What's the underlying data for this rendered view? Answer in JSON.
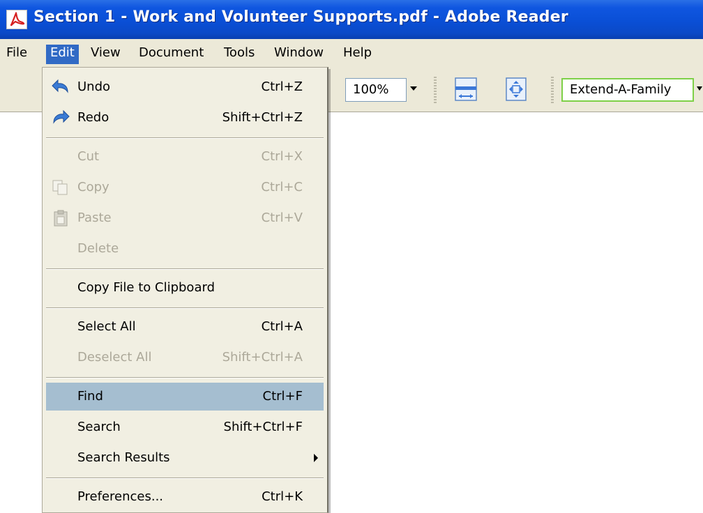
{
  "window": {
    "title": "Section 1 - Work and Volunteer Supports.pdf - Adobe Reader",
    "app_icon": "adobe-reader-icon",
    "title_bar_color": "#0a4fd6"
  },
  "menubar": {
    "items": [
      {
        "label": "File"
      },
      {
        "label": "Edit",
        "active": true
      },
      {
        "label": "View"
      },
      {
        "label": "Document"
      },
      {
        "label": "Tools"
      },
      {
        "label": "Window"
      },
      {
        "label": "Help"
      }
    ]
  },
  "toolbar": {
    "zoom_value": "100%",
    "fit_width_icon": "fit-width-icon",
    "fit_page_icon": "fit-page-icon",
    "search_value": "Extend-A-Family"
  },
  "edit_menu": {
    "items": [
      {
        "label": "Undo",
        "shortcut": "Ctrl+Z",
        "icon": "undo-icon",
        "enabled": true
      },
      {
        "label": "Redo",
        "shortcut": "Shift+Ctrl+Z",
        "icon": "redo-icon",
        "enabled": true
      },
      {
        "label": "Cut",
        "shortcut": "Ctrl+X",
        "enabled": false
      },
      {
        "label": "Copy",
        "shortcut": "Ctrl+C",
        "icon": "copy-icon",
        "enabled": false
      },
      {
        "label": "Paste",
        "shortcut": "Ctrl+V",
        "icon": "paste-icon",
        "enabled": false
      },
      {
        "label": "Delete",
        "shortcut": "",
        "enabled": false
      },
      {
        "label": "Copy File to Clipboard",
        "shortcut": "",
        "enabled": true
      },
      {
        "label": "Select All",
        "shortcut": "Ctrl+A",
        "enabled": true
      },
      {
        "label": "Deselect All",
        "shortcut": "Shift+Ctrl+A",
        "enabled": false
      },
      {
        "label": "Find",
        "shortcut": "Ctrl+F",
        "enabled": true,
        "highlighted": true
      },
      {
        "label": "Search",
        "shortcut": "Shift+Ctrl+F",
        "enabled": true
      },
      {
        "label": "Search Results",
        "shortcut": "",
        "enabled": true,
        "submenu": true
      },
      {
        "label": "Preferences...",
        "shortcut": "Ctrl+K",
        "enabled": true
      }
    ],
    "highlight_color": "#a5bed0",
    "disabled_color": "#aca899"
  }
}
